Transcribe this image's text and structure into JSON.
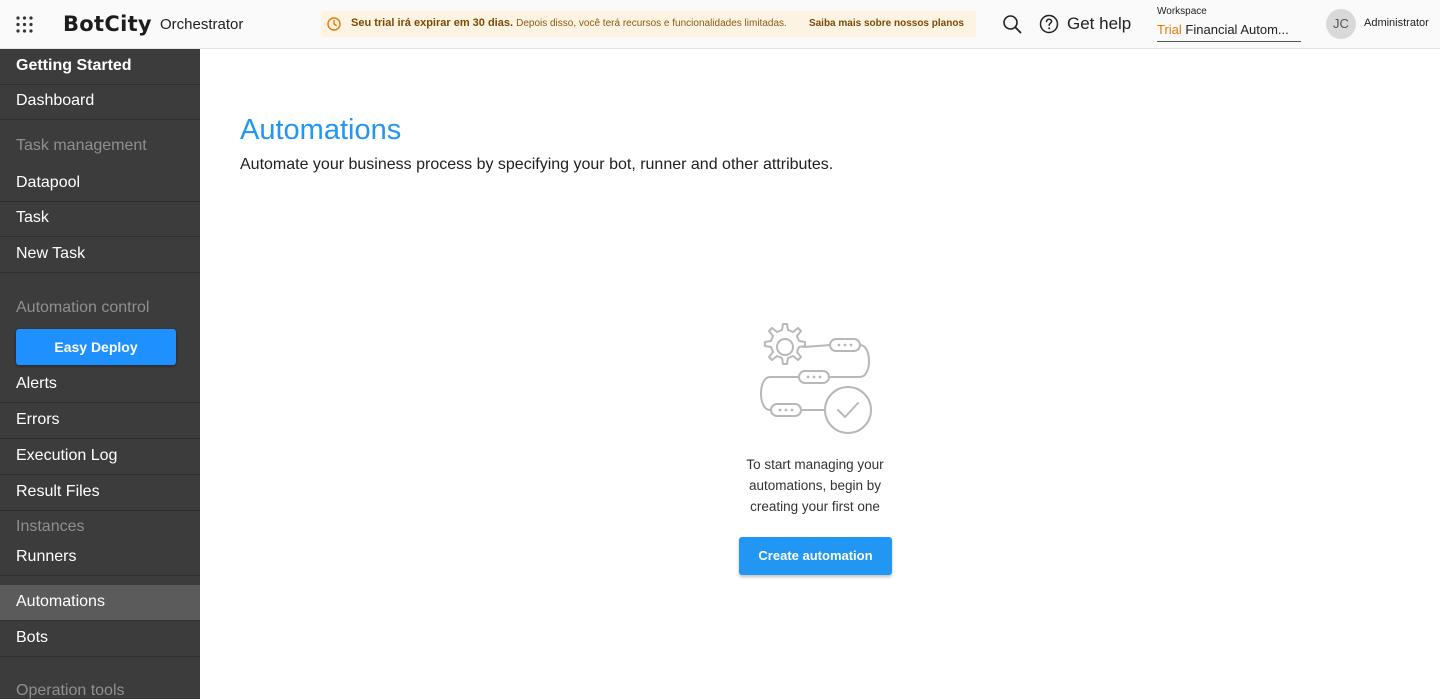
{
  "header": {
    "logo": "BotCity",
    "app_name": "Orchestrator",
    "trial_banner": {
      "strong": "Seu trial irá expirar em 30 dias.",
      "description": "Depois disso, você terá recursos e funcionalidades limitadas.",
      "link": "Saiba mais sobre nossos planos"
    },
    "help_label": "Get help",
    "workspace": {
      "label": "Workspace",
      "badge": "Trial",
      "name": "Financial Autom..."
    },
    "user": {
      "initials": "JC",
      "role": "Administrator"
    }
  },
  "sidebar": {
    "getting_started": "Getting Started",
    "dashboard": "Dashboard",
    "section_task_management": "Task management",
    "datapool": "Datapool",
    "task": "Task",
    "new_task": "New Task",
    "section_automation_control": "Automation control",
    "easy_deploy": "Easy Deploy",
    "alerts": "Alerts",
    "errors": "Errors",
    "execution_log": "Execution Log",
    "result_files": "Result Files",
    "section_instances": "Instances",
    "runners": "Runners",
    "automations": "Automations",
    "bots": "Bots",
    "section_operation_tools": "Operation tools"
  },
  "main": {
    "title": "Automations",
    "subtitle": "Automate your business process by specifying your bot, runner and other attributes.",
    "empty_line1": "To start managing your",
    "empty_line2": "automations, begin by",
    "empty_line3": "creating your first one",
    "create_button": "Create automation"
  },
  "colors": {
    "accent": "#2196f3",
    "sidebar_bg": "#3c3c3c",
    "sidebar_active": "#5b5b5b",
    "trial_badge": "#e7790b",
    "banner_bg": "#fdf3e2"
  }
}
